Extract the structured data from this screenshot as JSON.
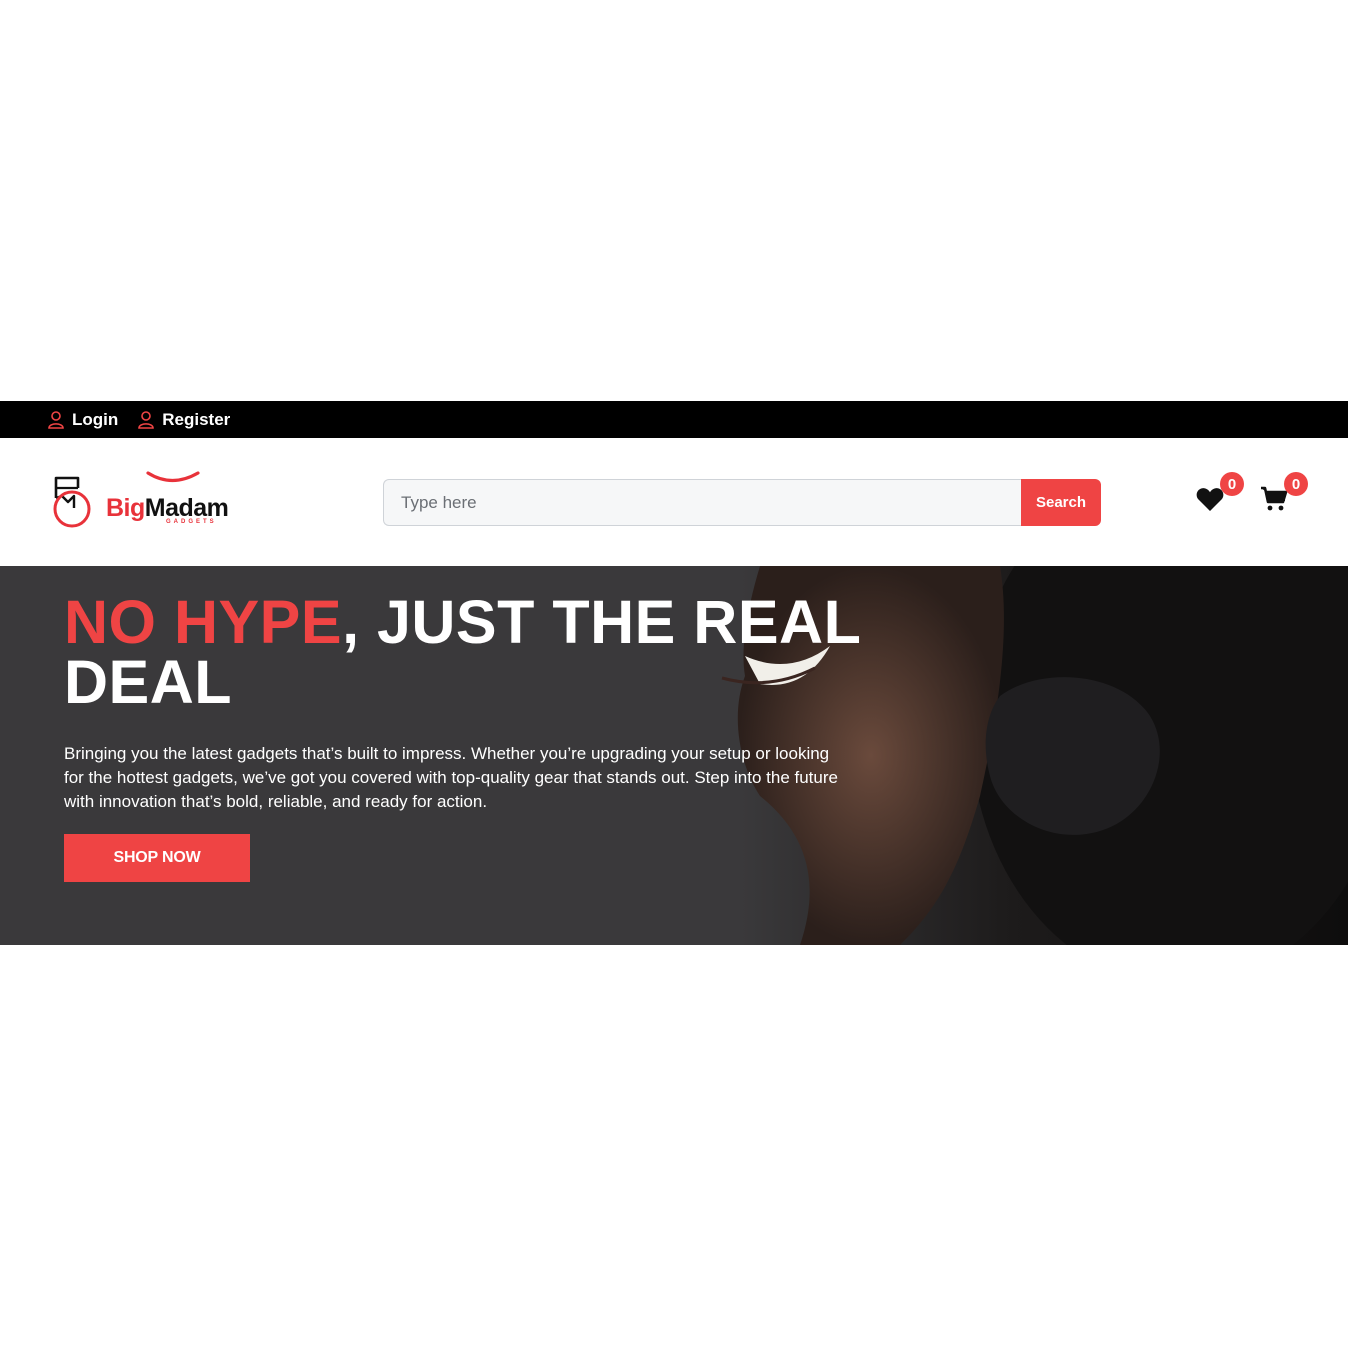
{
  "topbar": {
    "login_label": "Login",
    "register_label": "Register",
    "icon": "user-icon"
  },
  "header": {
    "logo": {
      "brand_big": "Big",
      "brand_madam": "Madam",
      "tagline": "GADGETS"
    },
    "search": {
      "placeholder": "Type here",
      "value": "",
      "button_label": "Search"
    },
    "wishlist": {
      "icon": "heart-icon",
      "count": "0"
    },
    "cart": {
      "icon": "cart-icon",
      "count": "0"
    }
  },
  "hero": {
    "title_accent": "NO HYPE",
    "title_rest": ", JUST THE REAL DEAL",
    "description": "Bringing you the latest gadgets that’s built to impress. Whether you’re upgrading your setup or looking for the hottest gadgets, we’ve got you covered with top-quality gear that stands out. Step into the future with innovation that’s bold, reliable, and ready for action.",
    "cta_label": "SHOP NOW"
  },
  "colors": {
    "accent": "#ef4444",
    "topbar_bg": "#000000",
    "hero_bg": "#3a393b"
  }
}
